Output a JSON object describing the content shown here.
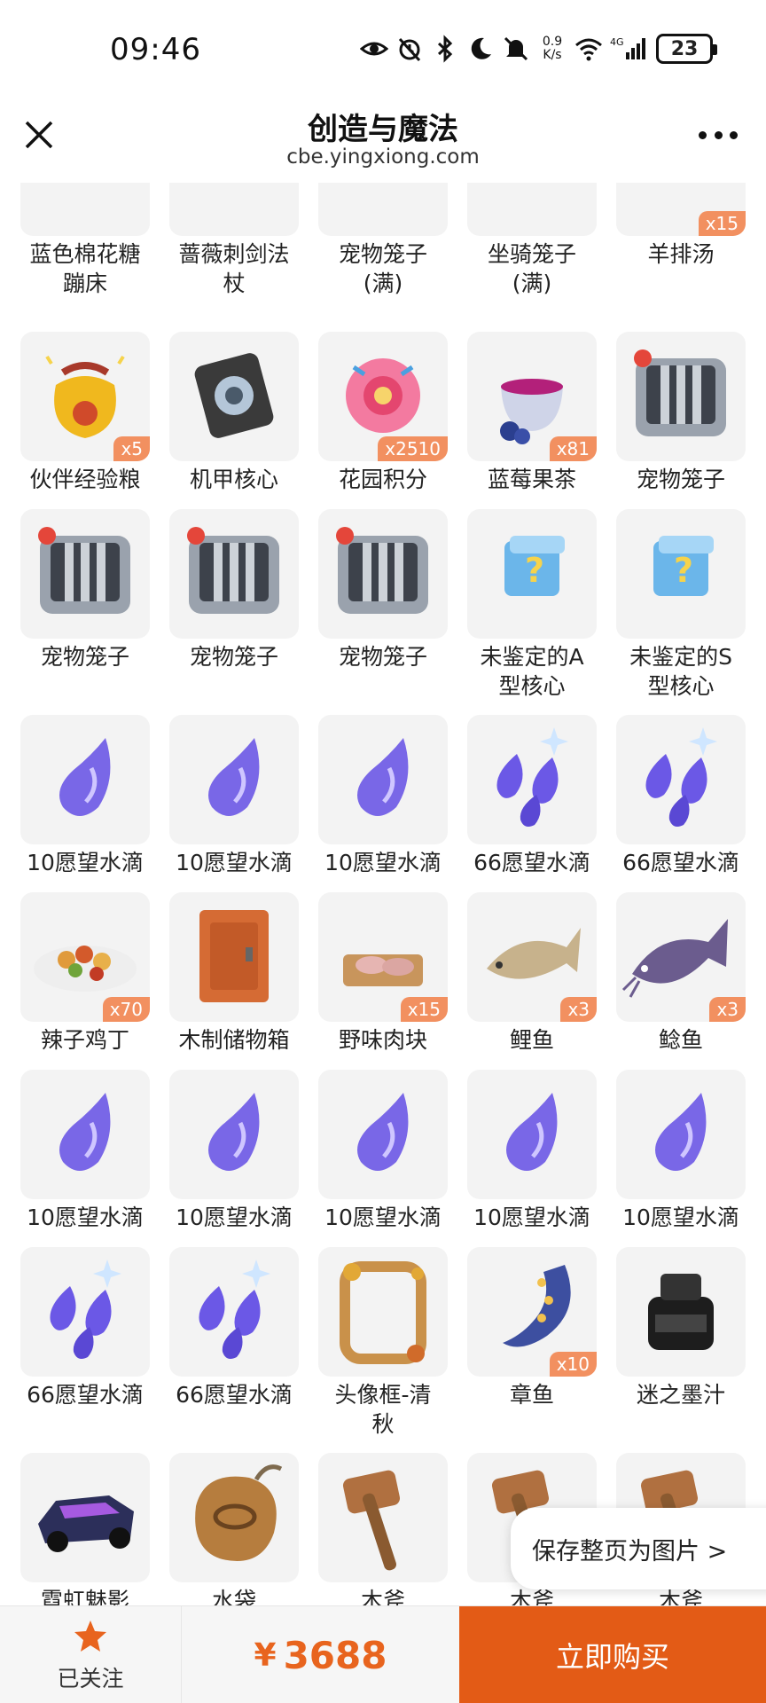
{
  "status": {
    "time": "09:46",
    "net_speed_top": "0.9",
    "net_speed_bottom": "K/s",
    "battery": "23",
    "icons": [
      "eye-icon",
      "alarm-icon",
      "bluetooth-icon",
      "moon-icon",
      "mute-icon",
      "wifi-icon",
      "signal-4g-icon"
    ]
  },
  "header": {
    "title": "创造与魔法",
    "url": "cbe.yingxiong.com",
    "close_icon": "close-icon",
    "more_icon": "more-icon"
  },
  "items": [
    {
      "label": "蓝色棉花糖蹦床",
      "badge": "",
      "icon": "trampoline"
    },
    {
      "label": "蔷薇刺剑法杖",
      "badge": "",
      "icon": "staff"
    },
    {
      "label": "宠物笼子(满)",
      "badge": "",
      "icon": "cage-full"
    },
    {
      "label": "坐骑笼子(满)",
      "badge": "",
      "icon": "cage-mount"
    },
    {
      "label": "羊排汤",
      "badge": "x15",
      "icon": "soup"
    },
    {
      "label": "伙伴经验粮",
      "badge": "x5",
      "icon": "bag"
    },
    {
      "label": "机甲核心",
      "badge": "",
      "icon": "core"
    },
    {
      "label": "花园积分",
      "badge": "x2510",
      "icon": "flower"
    },
    {
      "label": "蓝莓果茶",
      "badge": "x81",
      "icon": "tea"
    },
    {
      "label": "宠物笼子",
      "badge": "",
      "icon": "cage"
    },
    {
      "label": "宠物笼子",
      "badge": "",
      "icon": "cage"
    },
    {
      "label": "宠物笼子",
      "badge": "",
      "icon": "cage"
    },
    {
      "label": "宠物笼子",
      "badge": "",
      "icon": "cage"
    },
    {
      "label": "未鉴定的A型核心",
      "badge": "",
      "icon": "mystery"
    },
    {
      "label": "未鉴定的S型核心",
      "badge": "",
      "icon": "mystery"
    },
    {
      "label": "10愿望水滴",
      "badge": "",
      "icon": "drop"
    },
    {
      "label": "10愿望水滴",
      "badge": "",
      "icon": "drop"
    },
    {
      "label": "10愿望水滴",
      "badge": "",
      "icon": "drop"
    },
    {
      "label": "66愿望水滴",
      "badge": "",
      "icon": "drops"
    },
    {
      "label": "66愿望水滴",
      "badge": "",
      "icon": "drops"
    },
    {
      "label": "辣子鸡丁",
      "badge": "x70",
      "icon": "dish"
    },
    {
      "label": "木制储物箱",
      "badge": "",
      "icon": "box"
    },
    {
      "label": "野味肉块",
      "badge": "x15",
      "icon": "meat"
    },
    {
      "label": "鲤鱼",
      "badge": "x3",
      "icon": "carp"
    },
    {
      "label": "鲶鱼",
      "badge": "x3",
      "icon": "catfish"
    },
    {
      "label": "10愿望水滴",
      "badge": "",
      "icon": "drop"
    },
    {
      "label": "10愿望水滴",
      "badge": "",
      "icon": "drop"
    },
    {
      "label": "10愿望水滴",
      "badge": "",
      "icon": "drop"
    },
    {
      "label": "10愿望水滴",
      "badge": "",
      "icon": "drop"
    },
    {
      "label": "10愿望水滴",
      "badge": "",
      "icon": "drop"
    },
    {
      "label": "66愿望水滴",
      "badge": "",
      "icon": "drops"
    },
    {
      "label": "66愿望水滴",
      "badge": "",
      "icon": "drops"
    },
    {
      "label": "头像框-清秋",
      "badge": "",
      "icon": "frame"
    },
    {
      "label": "章鱼",
      "badge": "x10",
      "icon": "octopus"
    },
    {
      "label": "迷之墨汁",
      "badge": "",
      "icon": "ink"
    },
    {
      "label": "霓虹魅影",
      "badge": "",
      "icon": "car"
    },
    {
      "label": "水袋",
      "badge": "",
      "icon": "waterbag"
    },
    {
      "label": "木斧",
      "badge": "",
      "icon": "axe"
    },
    {
      "label": "木斧",
      "badge": "",
      "icon": "axe"
    },
    {
      "label": "木斧",
      "badge": "",
      "icon": "axe"
    }
  ],
  "save_pill": "保存整页为图片 >",
  "bottom": {
    "follow_label": "已关注",
    "currency": "¥",
    "price": "3688",
    "buy_label": "立即购买",
    "accent": "#e35b16",
    "price_color": "#e8641e"
  }
}
